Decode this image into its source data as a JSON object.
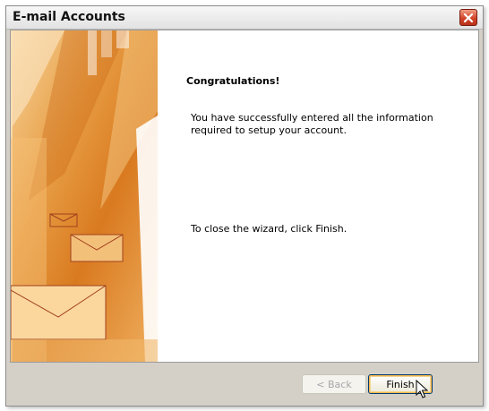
{
  "window": {
    "title": "E-mail Accounts"
  },
  "content": {
    "heading": "Congratulations!",
    "message": "You have successfully entered all the information required to setup your account.",
    "close_hint": "To close the wizard, click Finish."
  },
  "buttons": {
    "back_label": "< Back",
    "finish_label": "Finish"
  },
  "icons": {
    "close": "close-icon",
    "cursor": "mouse-pointer-icon",
    "banner": "envelope-banner"
  },
  "colors": {
    "banner_orange": "#e08a2c",
    "close_red": "#d2452a",
    "dialog_gray": "#d4d0c8"
  }
}
